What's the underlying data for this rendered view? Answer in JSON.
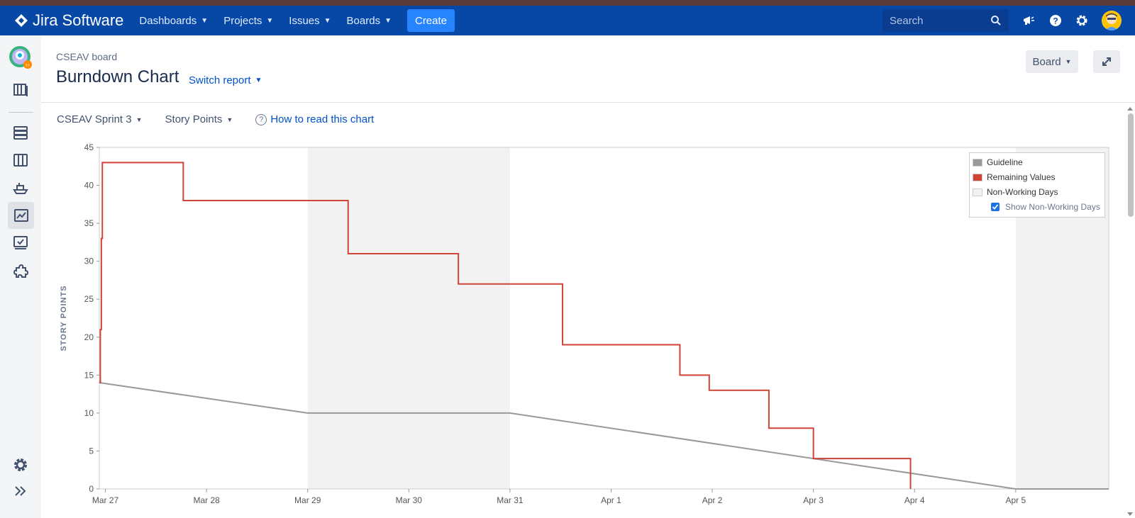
{
  "topnav": {
    "product": "Jira Software",
    "items": [
      {
        "label": "Dashboards"
      },
      {
        "label": "Projects"
      },
      {
        "label": "Issues"
      },
      {
        "label": "Boards"
      }
    ],
    "create_label": "Create",
    "search_placeholder": "Search"
  },
  "header": {
    "breadcrumb": "CSEAV board",
    "title": "Burndown Chart",
    "switch_report": "Switch report",
    "board_button": "Board"
  },
  "controls": {
    "sprint": "CSEAV Sprint 3",
    "estimation": "Story Points",
    "help_link": "How to read this chart"
  },
  "legend": {
    "guideline": "Guideline",
    "remaining": "Remaining Values",
    "non_working": "Non-Working Days",
    "show_non_working": "Show Non-Working Days"
  },
  "colors": {
    "nav": "#0747a6",
    "accent": "#2684ff",
    "remaining": "#d04437",
    "guideline": "#999999",
    "non_working": "#f2f2f2"
  },
  "chart_data": {
    "type": "line",
    "ylabel": "STORY POINTS",
    "ylim": [
      0,
      45
    ],
    "yticks": [
      0,
      5,
      10,
      15,
      20,
      25,
      30,
      35,
      40,
      45
    ],
    "xlim": [
      -0.06,
      9.92
    ],
    "xticks": [
      {
        "x": 0,
        "label": "Mar 27"
      },
      {
        "x": 1,
        "label": "Mar 28"
      },
      {
        "x": 2,
        "label": "Mar 29"
      },
      {
        "x": 3,
        "label": "Mar 30"
      },
      {
        "x": 4,
        "label": "Mar 31"
      },
      {
        "x": 5,
        "label": "Apr 1"
      },
      {
        "x": 6,
        "label": "Apr 2"
      },
      {
        "x": 7,
        "label": "Apr 3"
      },
      {
        "x": 8,
        "label": "Apr 4"
      },
      {
        "x": 9,
        "label": "Apr 5"
      }
    ],
    "non_working_days": [
      [
        2,
        4
      ],
      [
        9,
        9.92
      ]
    ],
    "series": [
      {
        "name": "Guideline",
        "points": [
          [
            -0.06,
            14
          ],
          [
            2,
            10
          ],
          [
            4,
            10
          ],
          [
            9,
            0
          ],
          [
            9.92,
            0
          ]
        ]
      },
      {
        "name": "Remaining Values",
        "step_points": [
          [
            -0.06,
            14
          ],
          [
            -0.05,
            21
          ],
          [
            -0.04,
            33
          ],
          [
            -0.03,
            43
          ],
          [
            0.77,
            38
          ],
          [
            2.4,
            31
          ],
          [
            3.49,
            27
          ],
          [
            4.52,
            19
          ],
          [
            5.68,
            15
          ],
          [
            5.97,
            13
          ],
          [
            6.56,
            8
          ],
          [
            7.0,
            4
          ],
          [
            7.96,
            0
          ]
        ]
      }
    ]
  }
}
